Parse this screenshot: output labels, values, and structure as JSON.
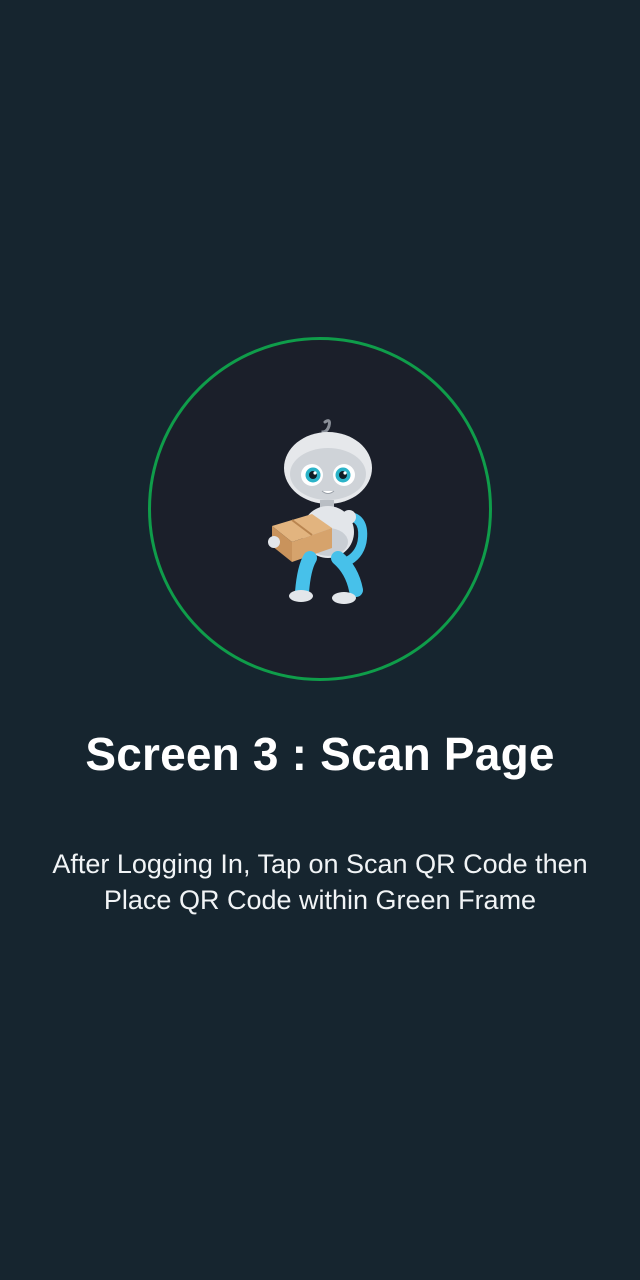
{
  "onboarding": {
    "title": "Screen 3 : Scan Page",
    "description": "After Logging In, Tap on Scan QR Code then Place QR Code within Green Frame",
    "illustration_icon": "robot-carrying-box-icon",
    "frame_color": "#0f9d4a",
    "background_color": "#16252f"
  }
}
